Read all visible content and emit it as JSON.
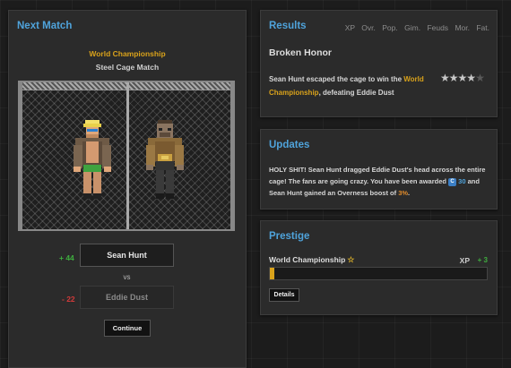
{
  "next_match": {
    "title": "Next Match",
    "championship": "World Championship",
    "match_type": "Steel Cage Match",
    "winner": {
      "name": "Sean Hunt",
      "change": "+ 44"
    },
    "vs": "vs",
    "loser": {
      "name": "Eddie Dust",
      "change": "- 22"
    },
    "continue_label": "Continue"
  },
  "results": {
    "title": "Results",
    "columns": [
      "XP",
      "Ovr.",
      "Pop.",
      "Gim.",
      "Feuds",
      "Mor.",
      "Fat."
    ],
    "match_name": "Broken Honor",
    "text_before": "Sean Hunt escaped the cage to win the ",
    "text_highlight": "World Championship",
    "text_after": ", defeating Eddie Dust",
    "rating": 4.5,
    "rating_max": 5
  },
  "updates": {
    "title": "Updates",
    "text_before": "HOLY SHIT! Sean Hunt dragged Eddie Dust's head across the entire cage! The fans are going crazy. You have been awarded",
    "gem_icon": "C",
    "gem_value": "30",
    "text_middle": "and Sean Hunt gained an Overness boost of",
    "boost": "3%",
    "text_end": "."
  },
  "prestige": {
    "title": "Prestige",
    "label": "World Championship",
    "star_icon": "☆",
    "xp_label": "XP",
    "xp_value": "+ 3",
    "progress": 0.02,
    "details_label": "Details"
  },
  "colors": {
    "accent": "#4fa3db",
    "gold": "#d9a21b",
    "positive": "#3fae3f",
    "negative": "#d23a3a"
  }
}
